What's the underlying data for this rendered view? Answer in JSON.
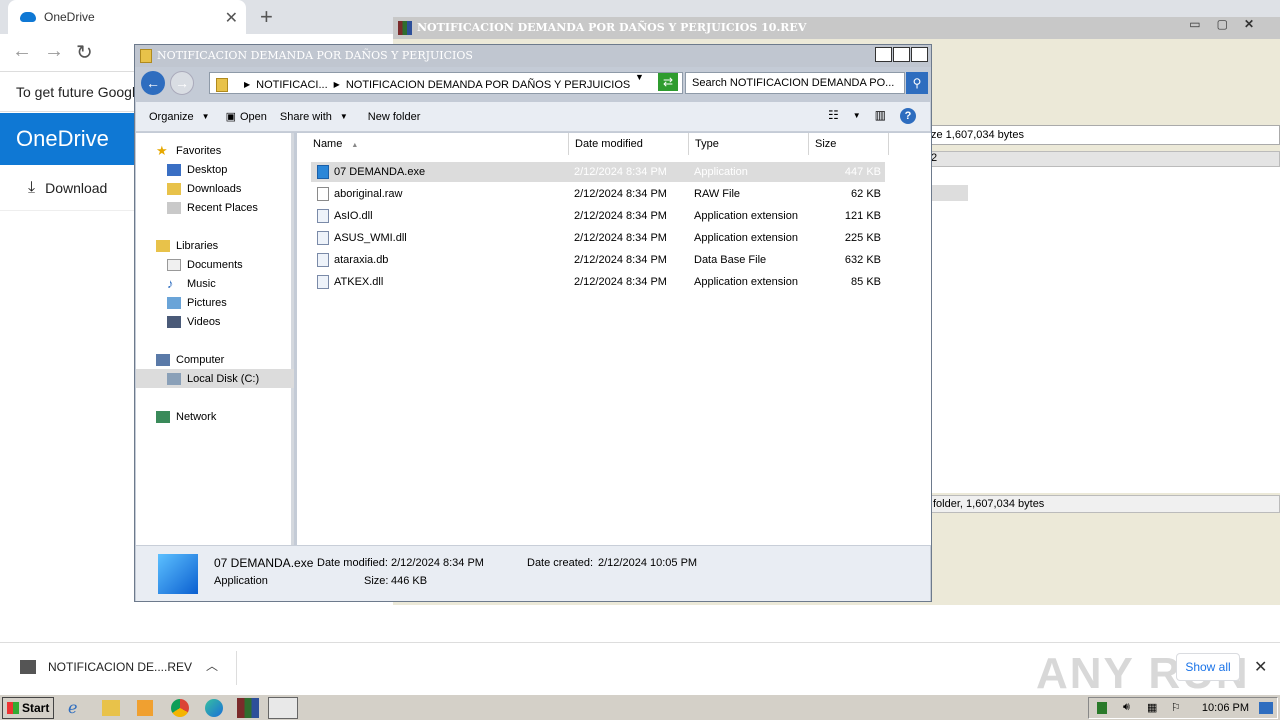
{
  "browser": {
    "tab_title": "OneDrive",
    "tab_close": "✕",
    "new_tab": "+",
    "infobar_text": "To get future Google",
    "onedrive_title": "OneDrive",
    "download_label": "Download"
  },
  "winrar": {
    "title": "NOTIFICACION DEMANDA POR DAÑOS Y PERJUICIOS 10.REV",
    "info_text": "ze 1,607,034 bytes",
    "header_fragment": "2",
    "status_text": "folder, 1,607,034 bytes"
  },
  "explorer": {
    "title": "NOTIFICACION DEMANDA POR DAÑOS Y PERJUICIOS",
    "address": {
      "crumb1": "NOTIFICACI...",
      "crumb2": "NOTIFICACION DEMANDA POR DAÑOS Y PERJUICIOS"
    },
    "search_placeholder": "Search NOTIFICACION DEMANDA PO...",
    "toolbar": {
      "organize": "Organize",
      "open": "Open",
      "share_with": "Share with",
      "new_folder": "New folder",
      "help": "?"
    },
    "nav": {
      "favorites": "Favorites",
      "desktop": "Desktop",
      "downloads": "Downloads",
      "recent_places": "Recent Places",
      "libraries": "Libraries",
      "documents": "Documents",
      "music": "Music",
      "pictures": "Pictures",
      "videos": "Videos",
      "computer": "Computer",
      "local_disk": "Local Disk (C:)",
      "network": "Network"
    },
    "columns": {
      "name": "Name",
      "date_modified": "Date modified",
      "type": "Type",
      "size": "Size"
    },
    "files": [
      {
        "name": "07 DEMANDA.exe",
        "date": "2/12/2024 8:34 PM",
        "type": "Application",
        "size": "447 KB"
      },
      {
        "name": "aboriginal.raw",
        "date": "2/12/2024 8:34 PM",
        "type": "RAW File",
        "size": "62 KB"
      },
      {
        "name": "AsIO.dll",
        "date": "2/12/2024 8:34 PM",
        "type": "Application extension",
        "size": "121 KB"
      },
      {
        "name": "ASUS_WMI.dll",
        "date": "2/12/2024 8:34 PM",
        "type": "Application extension",
        "size": "225 KB"
      },
      {
        "name": "ataraxia.db",
        "date": "2/12/2024 8:34 PM",
        "type": "Data Base File",
        "size": "632 KB"
      },
      {
        "name": "ATKEX.dll",
        "date": "2/12/2024 8:34 PM",
        "type": "Application extension",
        "size": "85 KB"
      }
    ],
    "details": {
      "name": "07 DEMANDA.exe",
      "type": "Application",
      "date_modified_label": "Date modified:",
      "date_modified": "2/12/2024 8:34 PM",
      "size_label": "Size:",
      "size": "446 KB",
      "date_created_label": "Date created:",
      "date_created": "2/12/2024 10:05 PM"
    }
  },
  "download_bar": {
    "item_name": "NOTIFICACION DE....REV",
    "show_all": "Show all",
    "watermark": "ANY RUN"
  },
  "taskbar": {
    "start": "Start",
    "clock": "10:06 PM"
  }
}
